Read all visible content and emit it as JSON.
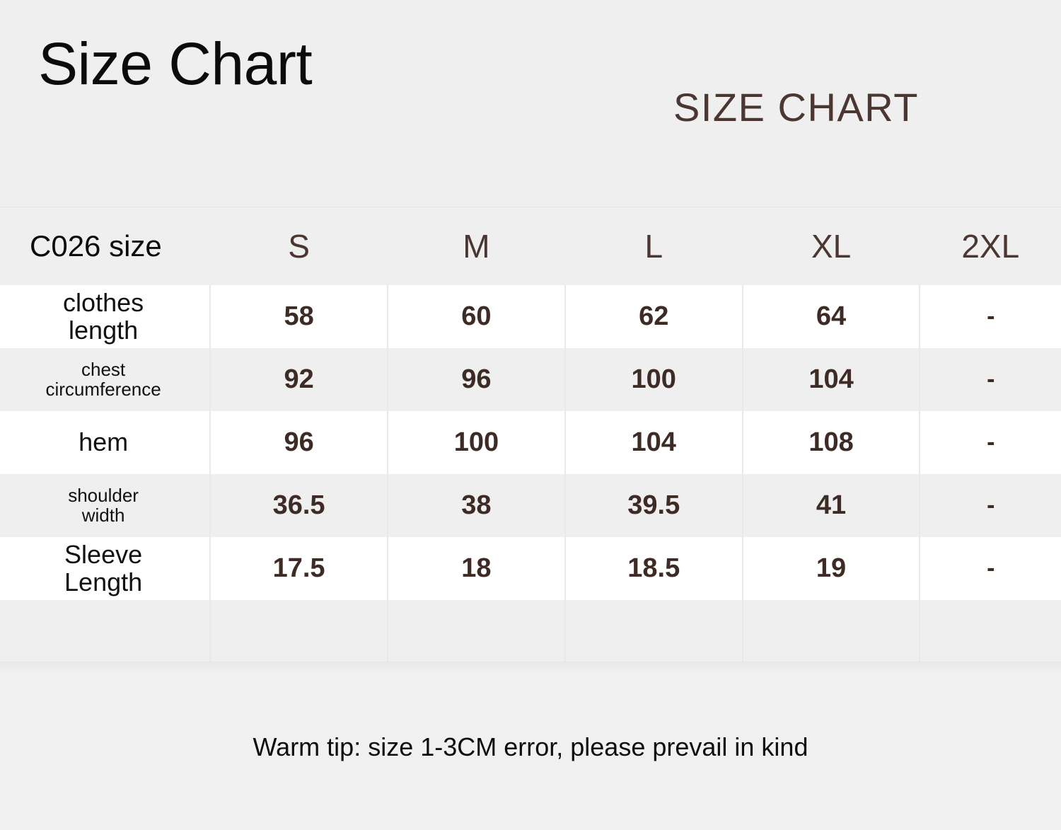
{
  "page": {
    "background_color": "#efefef",
    "accent_color": "#4a3732",
    "text_color": "#0b0b0b",
    "row_alt_color": "#efefef",
    "row_base_color": "#ffffff",
    "border_color": "#e9e9e9"
  },
  "header": {
    "main_title": "Size Chart",
    "sub_title": "SIZE CHART"
  },
  "footer": {
    "warm_tip": "Warm tip: size 1-3CM error, please prevail in kind"
  },
  "chart_data": {
    "type": "table",
    "title": "Size Chart",
    "corner_label": "C026 size",
    "categories": [
      "S",
      "M",
      "L",
      "XL",
      "2XL"
    ],
    "measurement_labels": [
      "clothes length",
      "chest circumference",
      "hem",
      "shoulder width",
      "Sleeve Length"
    ],
    "series": [
      {
        "name": "clothes length",
        "values": [
          "58",
          "60",
          "62",
          "64",
          "-"
        ]
      },
      {
        "name": "chest circumference",
        "values": [
          "92",
          "96",
          "100",
          "104",
          "-"
        ]
      },
      {
        "name": "hem",
        "values": [
          "96",
          "100",
          "104",
          "108",
          "-"
        ]
      },
      {
        "name": "shoulder width",
        "values": [
          "36.5",
          "38",
          "39.5",
          "41",
          "-"
        ]
      },
      {
        "name": "Sleeve Length",
        "values": [
          "17.5",
          "18",
          "18.5",
          "19",
          "-"
        ]
      }
    ],
    "unit": "CM",
    "note": "Warm tip: size 1-3CM error, please prevail in kind"
  },
  "table": {
    "corner_label": "C026 size",
    "columns": [
      "S",
      "M",
      "L",
      "XL",
      "2XL"
    ],
    "rows": [
      {
        "label": "clothes length",
        "label_line1": "clothes",
        "label_line2": "length",
        "label_size": "big",
        "shade": "white",
        "values": [
          "58",
          "60",
          "62",
          "64",
          "-"
        ]
      },
      {
        "label": "chest circumference",
        "label_line1": "chest",
        "label_line2": "circumference",
        "label_size": "small",
        "shade": "grey",
        "values": [
          "92",
          "96",
          "100",
          "104",
          "-"
        ]
      },
      {
        "label": "hem",
        "label_line1": "hem",
        "label_line2": "",
        "label_size": "big",
        "shade": "white",
        "values": [
          "96",
          "100",
          "104",
          "108",
          "-"
        ]
      },
      {
        "label": "shoulder width",
        "label_line1": "shoulder",
        "label_line2": "width",
        "label_size": "small",
        "shade": "grey",
        "values": [
          "36.5",
          "38",
          "39.5",
          "41",
          "-"
        ]
      },
      {
        "label": "Sleeve Length",
        "label_line1": "Sleeve",
        "label_line2": "Length",
        "label_size": "big",
        "shade": "white",
        "values": [
          "17.5",
          "18",
          "18.5",
          "19",
          "-"
        ]
      },
      {
        "label": "",
        "label_line1": "",
        "label_line2": "",
        "label_size": "big",
        "shade": "grey",
        "empty": true,
        "values": [
          "",
          "",
          "",
          "",
          ""
        ]
      }
    ]
  }
}
